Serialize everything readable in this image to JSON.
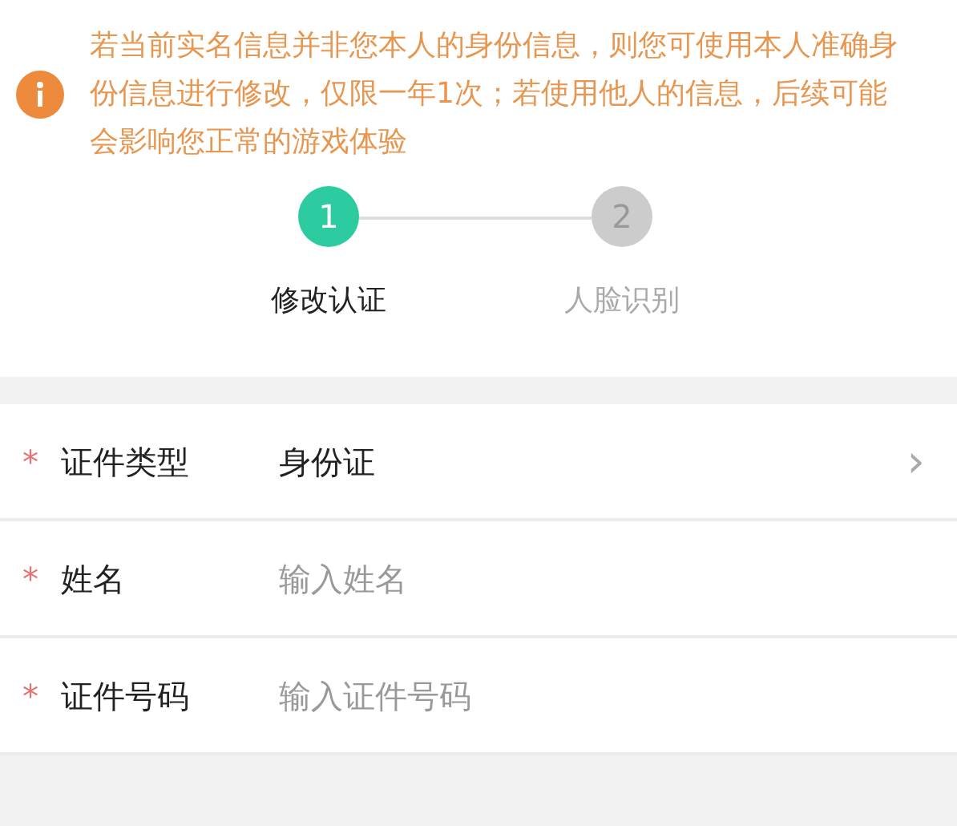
{
  "notice": {
    "text": "若当前实名信息并非您本人的身份信息，则您可使用本人准确身份信息进行修改，仅限一年1次；若使用他人的信息，后续可能会影响您正常的游戏体验"
  },
  "steps": [
    {
      "number": "1",
      "label": "修改认证",
      "selected": true
    },
    {
      "number": "2",
      "label": "人脸识别",
      "selected": false
    }
  ],
  "fields": [
    {
      "kind": "select",
      "required": true,
      "required_mark": "*",
      "label": "证件类型",
      "value": "身份证",
      "chevron": "›"
    },
    {
      "kind": "input",
      "required": true,
      "required_mark": "*",
      "label": "姓名",
      "placeholder": "输入姓名"
    },
    {
      "kind": "input",
      "required": true,
      "required_mark": "*",
      "label": "证件号码",
      "placeholder": "输入证件号码"
    }
  ]
}
